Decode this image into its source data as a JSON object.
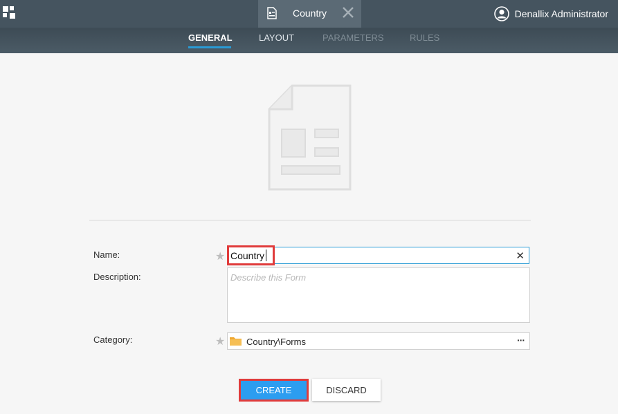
{
  "topbar": {
    "active_tab": {
      "label": "Country",
      "icon": "form-document-icon"
    },
    "user": {
      "name": "Denallix Administrator",
      "icon": "user-avatar-icon"
    }
  },
  "subnav": {
    "tabs": [
      {
        "label": "GENERAL",
        "state": "active"
      },
      {
        "label": "LAYOUT",
        "state": "enabled"
      },
      {
        "label": "PARAMETERS",
        "state": "disabled"
      },
      {
        "label": "RULES",
        "state": "disabled"
      }
    ]
  },
  "form": {
    "name_label": "Name:",
    "name_value": "Country",
    "description_label": "Description:",
    "description_placeholder": "Describe this Form",
    "category_label": "Category:",
    "category_value": "Country\\Forms",
    "required_marker": "★",
    "clear_glyph": "✕",
    "more_glyph": "···"
  },
  "actions": {
    "create_label": "CREATE",
    "discard_label": "DISCARD"
  },
  "colors": {
    "accent": "#2c9df0",
    "highlight": "#e03b3b",
    "topbar": "#45545f"
  }
}
